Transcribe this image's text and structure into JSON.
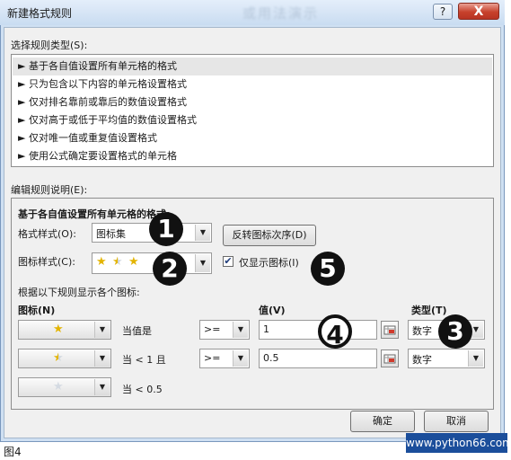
{
  "dialog": {
    "title": "新建格式规则",
    "blurred_background_text": "或用法演示",
    "help_glyph": "?",
    "close_glyph": "X"
  },
  "rule_type": {
    "label": "选择规则类型(S):",
    "items": [
      {
        "label": "► 基于各自值设置所有单元格的格式",
        "selected": true
      },
      {
        "label": "► 只为包含以下内容的单元格设置格式",
        "selected": false
      },
      {
        "label": "► 仅对排名靠前或靠后的数值设置格式",
        "selected": false
      },
      {
        "label": "► 仅对高于或低于平均值的数值设置格式",
        "selected": false
      },
      {
        "label": "► 仅对唯一值或重复值设置格式",
        "selected": false
      },
      {
        "label": "► 使用公式确定要设置格式的单元格",
        "selected": false
      }
    ]
  },
  "edit_rule": {
    "label": "编辑规则说明(E):",
    "heading": "基于各自值设置所有单元格的格式:",
    "format_style_label": "格式样式(O):",
    "format_style_value": "图标集",
    "reverse_button": "反转图标次序(D)",
    "icon_style_label": "图标样式(C):",
    "show_icon_only_label": "仅显示图标(I)",
    "show_icon_only_checked": true,
    "rules_caption": "根据以下规则显示各个图标:",
    "col_icon": "图标(N)",
    "col_value": "值(V)",
    "col_type": "类型(T)",
    "rows": [
      {
        "icon": "full-star",
        "condition": "当值是",
        "operator": ">=",
        "value": "1",
        "type": "数字"
      },
      {
        "icon": "half-star",
        "condition": "当 < 1 且",
        "operator": ">=",
        "value": "0.5",
        "type": "数字"
      },
      {
        "icon": "empty-star",
        "condition": "当 < 0.5"
      }
    ]
  },
  "buttons": {
    "ok": "确定",
    "cancel": "取消"
  },
  "annotations": [
    "1",
    "2",
    "3",
    "4",
    "5"
  ],
  "watermark": "www.python66.com",
  "caption": "图4",
  "colors": {
    "accent_blue": "#1b4e9b",
    "star_gold": "#e3b400",
    "close_red": "#c7412c"
  }
}
